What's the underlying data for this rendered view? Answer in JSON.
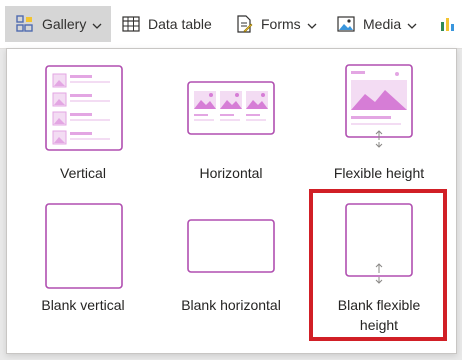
{
  "ribbon": {
    "gallery_label": "Gallery",
    "datatable_label": "Data table",
    "forms_label": "Forms",
    "media_label": "Media"
  },
  "gallery_menu": {
    "items": [
      {
        "label": "Vertical"
      },
      {
        "label": "Horizontal"
      },
      {
        "label": "Flexible height"
      },
      {
        "label": "Blank vertical"
      },
      {
        "label": "Blank horizontal"
      },
      {
        "label": "Blank flexible height"
      }
    ],
    "highlighted_item": "Blank flexible height"
  },
  "colors": {
    "accent_purple": "#b04fb0",
    "light_purple": "#f3dcf3",
    "mid_purple": "#e3a6e3",
    "highlight_red": "#d11f26",
    "active_tab_bg": "#d6d6d6"
  }
}
